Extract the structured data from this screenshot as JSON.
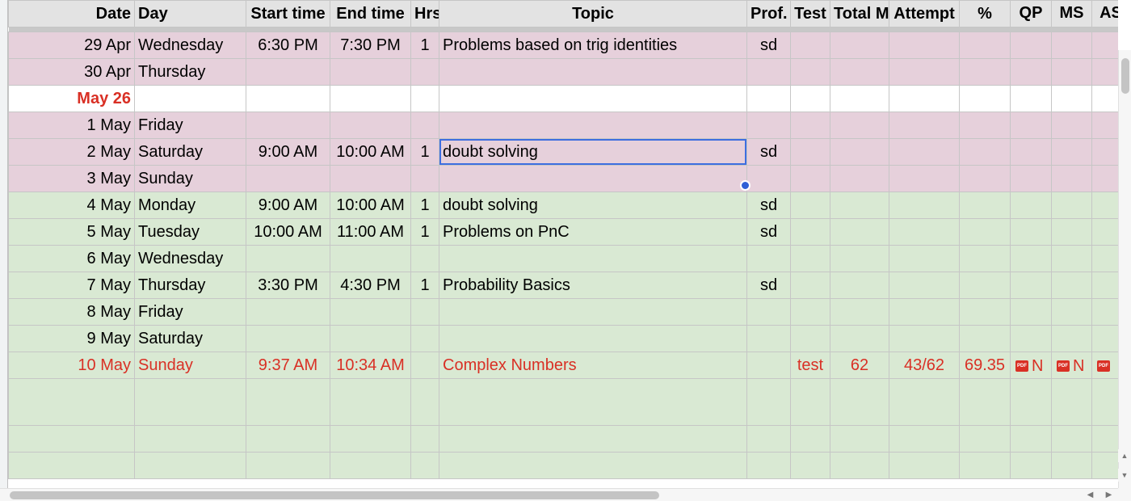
{
  "header": {
    "date": "Date",
    "day": "Day",
    "start": "Start time",
    "end": "End time",
    "hrs": "Hrs",
    "topic": "Topic",
    "prof": "Prof.",
    "test": "Test",
    "total_marks": "Total Marks",
    "attempt": "Attempt",
    "percent": "%",
    "qp": "QP",
    "ms": "MS",
    "as": "AS"
  },
  "rows": [
    {
      "date": "29 Apr",
      "day": "Wednesday",
      "start": "6:30 PM",
      "end": "7:30 PM",
      "hrs": "1",
      "topic": "Problems based on trig identities",
      "prof": "sd"
    },
    {
      "date": "30 Apr",
      "day": "Thursday"
    },
    {
      "month": "May 26"
    },
    {
      "date": "1 May",
      "day": "Friday"
    },
    {
      "date": "2 May",
      "day": "Saturday",
      "start": "9:00 AM",
      "end": "10:00 AM",
      "hrs": "1",
      "topic": "doubt solving",
      "prof": "sd"
    },
    {
      "date": "3 May",
      "day": "Sunday"
    },
    {
      "date": "4 May",
      "day": "Monday",
      "start": "9:00 AM",
      "end": "10:00 AM",
      "hrs": "1",
      "topic": "doubt solving",
      "prof": "sd"
    },
    {
      "date": "5 May",
      "day": "Tuesday",
      "start": "10:00 AM",
      "end": "11:00 AM",
      "hrs": "1",
      "topic": "Problems on PnC",
      "prof": "sd"
    },
    {
      "date": "6 May",
      "day": "Wednesday"
    },
    {
      "date": "7 May",
      "day": "Thursday",
      "start": "3:30 PM",
      "end": "4:30 PM",
      "hrs": "1",
      "topic": "Probability Basics",
      "prof": "sd"
    },
    {
      "date": "8 May",
      "day": "Friday"
    },
    {
      "date": "9 May",
      "day": "Saturday"
    },
    {
      "date": "10 May",
      "day": "Sunday",
      "start": "9:37 AM",
      "end": "10:34 AM",
      "topic": "Complex Numbers",
      "test": "test",
      "total_marks": "62",
      "attempt": "43/62",
      "percent": "69.35",
      "qp_chip": "N",
      "ms_chip": "N"
    }
  ],
  "chip": {
    "pdf_label": "PDF"
  },
  "colors": {
    "pink_row": "#e6d0db",
    "green_row": "#d9e9d3",
    "red_text": "#d93025",
    "selection": "#3d6ee0"
  }
}
